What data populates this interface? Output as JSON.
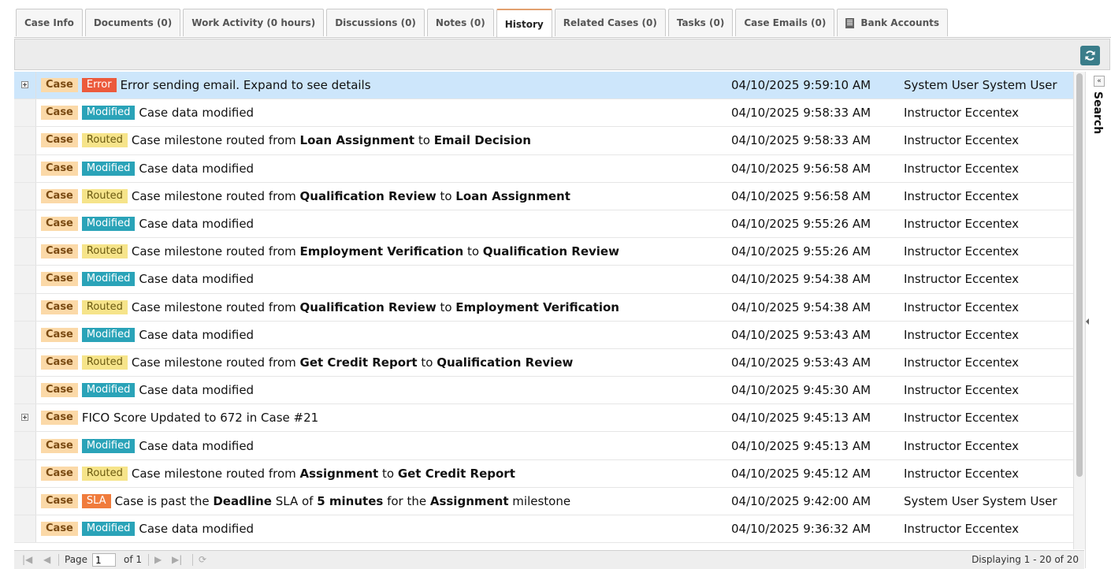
{
  "tabs": [
    {
      "label": "Case Info"
    },
    {
      "label": "Documents (0)"
    },
    {
      "label": "Work Activity (0 hours)"
    },
    {
      "label": "Discussions (0)"
    },
    {
      "label": "Notes (0)"
    },
    {
      "label": "History",
      "active": true
    },
    {
      "label": "Related Cases (0)"
    },
    {
      "label": "Tasks (0)"
    },
    {
      "label": "Case Emails (0)"
    },
    {
      "label": "Bank Accounts",
      "icon": "bank-icon"
    }
  ],
  "badge_colors": {
    "case": "#fbd9a8",
    "error": "#ec5a3c",
    "modified": "#2aa3b8",
    "routed": "#f6e48a",
    "sla": "#f07b3c"
  },
  "rows": [
    {
      "expandable": true,
      "selected": true,
      "tags": [
        {
          "type": "case",
          "text": "Case"
        },
        {
          "type": "error",
          "text": "Error"
        }
      ],
      "msg": [
        {
          "t": "Error sending email. Expand to see details"
        }
      ],
      "date": "04/10/2025 9:59:10 AM",
      "user": "System User System User"
    },
    {
      "tags": [
        {
          "type": "case",
          "text": "Case"
        },
        {
          "type": "modified",
          "text": "Modified"
        }
      ],
      "msg": [
        {
          "t": "Case data modified"
        }
      ],
      "date": "04/10/2025 9:58:33 AM",
      "user": "Instructor Eccentex"
    },
    {
      "tags": [
        {
          "type": "case",
          "text": "Case"
        },
        {
          "type": "routed",
          "text": "Routed"
        }
      ],
      "msg": [
        {
          "t": "Case milestone routed from "
        },
        {
          "t": "Loan Assignment",
          "b": true
        },
        {
          "t": " to "
        },
        {
          "t": "Email Decision",
          "b": true
        }
      ],
      "date": "04/10/2025 9:58:33 AM",
      "user": "Instructor Eccentex"
    },
    {
      "tags": [
        {
          "type": "case",
          "text": "Case"
        },
        {
          "type": "modified",
          "text": "Modified"
        }
      ],
      "msg": [
        {
          "t": "Case data modified"
        }
      ],
      "date": "04/10/2025 9:56:58 AM",
      "user": "Instructor Eccentex"
    },
    {
      "tags": [
        {
          "type": "case",
          "text": "Case"
        },
        {
          "type": "routed",
          "text": "Routed"
        }
      ],
      "msg": [
        {
          "t": "Case milestone routed from "
        },
        {
          "t": "Qualification Review",
          "b": true
        },
        {
          "t": " to "
        },
        {
          "t": "Loan Assignment",
          "b": true
        }
      ],
      "date": "04/10/2025 9:56:58 AM",
      "user": "Instructor Eccentex"
    },
    {
      "tags": [
        {
          "type": "case",
          "text": "Case"
        },
        {
          "type": "modified",
          "text": "Modified"
        }
      ],
      "msg": [
        {
          "t": "Case data modified"
        }
      ],
      "date": "04/10/2025 9:55:26 AM",
      "user": "Instructor Eccentex"
    },
    {
      "tags": [
        {
          "type": "case",
          "text": "Case"
        },
        {
          "type": "routed",
          "text": "Routed"
        }
      ],
      "msg": [
        {
          "t": "Case milestone routed from "
        },
        {
          "t": "Employment Verification",
          "b": true
        },
        {
          "t": " to "
        },
        {
          "t": "Qualification Review",
          "b": true
        }
      ],
      "date": "04/10/2025 9:55:26 AM",
      "user": "Instructor Eccentex"
    },
    {
      "tags": [
        {
          "type": "case",
          "text": "Case"
        },
        {
          "type": "modified",
          "text": "Modified"
        }
      ],
      "msg": [
        {
          "t": "Case data modified"
        }
      ],
      "date": "04/10/2025 9:54:38 AM",
      "user": "Instructor Eccentex"
    },
    {
      "tags": [
        {
          "type": "case",
          "text": "Case"
        },
        {
          "type": "routed",
          "text": "Routed"
        }
      ],
      "msg": [
        {
          "t": "Case milestone routed from "
        },
        {
          "t": "Qualification Review",
          "b": true
        },
        {
          "t": " to "
        },
        {
          "t": "Employment Verification",
          "b": true
        }
      ],
      "date": "04/10/2025 9:54:38 AM",
      "user": "Instructor Eccentex"
    },
    {
      "tags": [
        {
          "type": "case",
          "text": "Case"
        },
        {
          "type": "modified",
          "text": "Modified"
        }
      ],
      "msg": [
        {
          "t": "Case data modified"
        }
      ],
      "date": "04/10/2025 9:53:43 AM",
      "user": "Instructor Eccentex"
    },
    {
      "tags": [
        {
          "type": "case",
          "text": "Case"
        },
        {
          "type": "routed",
          "text": "Routed"
        }
      ],
      "msg": [
        {
          "t": "Case milestone routed from "
        },
        {
          "t": "Get Credit Report",
          "b": true
        },
        {
          "t": " to "
        },
        {
          "t": "Qualification Review",
          "b": true
        }
      ],
      "date": "04/10/2025 9:53:43 AM",
      "user": "Instructor Eccentex"
    },
    {
      "tags": [
        {
          "type": "case",
          "text": "Case"
        },
        {
          "type": "modified",
          "text": "Modified"
        }
      ],
      "msg": [
        {
          "t": "Case data modified"
        }
      ],
      "date": "04/10/2025 9:45:30 AM",
      "user": "Instructor Eccentex"
    },
    {
      "expandable": true,
      "tags": [
        {
          "type": "case",
          "text": "Case"
        }
      ],
      "msg": [
        {
          "t": "FICO Score Updated to 672 in Case #21"
        }
      ],
      "date": "04/10/2025 9:45:13 AM",
      "user": "Instructor Eccentex"
    },
    {
      "tags": [
        {
          "type": "case",
          "text": "Case"
        },
        {
          "type": "modified",
          "text": "Modified"
        }
      ],
      "msg": [
        {
          "t": "Case data modified"
        }
      ],
      "date": "04/10/2025 9:45:13 AM",
      "user": "Instructor Eccentex"
    },
    {
      "tags": [
        {
          "type": "case",
          "text": "Case"
        },
        {
          "type": "routed",
          "text": "Routed"
        }
      ],
      "msg": [
        {
          "t": "Case milestone routed from "
        },
        {
          "t": "Assignment",
          "b": true
        },
        {
          "t": " to "
        },
        {
          "t": "Get Credit Report",
          "b": true
        }
      ],
      "date": "04/10/2025 9:45:12 AM",
      "user": "Instructor Eccentex"
    },
    {
      "tags": [
        {
          "type": "case",
          "text": "Case"
        },
        {
          "type": "sla",
          "text": "SLA"
        }
      ],
      "msg": [
        {
          "t": "Case is past the "
        },
        {
          "t": "Deadline",
          "b": true
        },
        {
          "t": " SLA of "
        },
        {
          "t": "5 minutes",
          "b": true
        },
        {
          "t": " for the "
        },
        {
          "t": "Assignment",
          "b": true
        },
        {
          "t": " milestone"
        }
      ],
      "date": "04/10/2025 9:42:00 AM",
      "user": "System User System User"
    },
    {
      "tags": [
        {
          "type": "case",
          "text": "Case"
        },
        {
          "type": "modified",
          "text": "Modified"
        }
      ],
      "msg": [
        {
          "t": "Case data modified"
        }
      ],
      "date": "04/10/2025 9:36:32 AM",
      "user": "Instructor Eccentex"
    }
  ],
  "side_panel": {
    "label": "Search"
  },
  "pager": {
    "page_label": "Page",
    "page_value": "1",
    "of_label": "of 1",
    "display_info": "Displaying 1 - 20 of 20"
  }
}
